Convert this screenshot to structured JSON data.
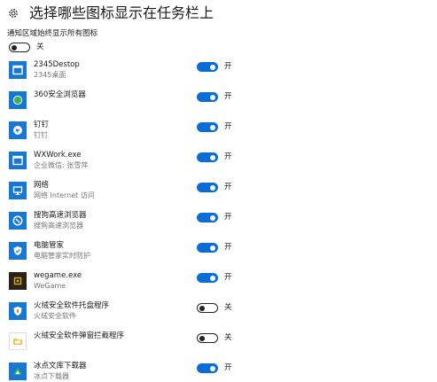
{
  "header": {
    "title": "选择哪些图标显示在任务栏上",
    "icon": "gear-icon"
  },
  "notification_area": {
    "label": "通知区域始终显示所有图标",
    "toggle_state": "关",
    "on": false
  },
  "apps": [
    {
      "name": "2345Destop",
      "sub": "2345桌面",
      "state": "开",
      "on": true,
      "icon": "app-2345-icon",
      "glyph": "window"
    },
    {
      "name": "360安全浏览器",
      "sub": "",
      "state": "开",
      "on": true,
      "icon": "app-360-browser-icon",
      "glyph": "green-circle"
    },
    {
      "name": "钉钉",
      "sub": "钉钉",
      "state": "开",
      "on": true,
      "icon": "app-dingtalk-icon",
      "glyph": "dingtalk"
    },
    {
      "name": "WXWork.exe",
      "sub": "企业微信: 张雪萍",
      "state": "开",
      "on": true,
      "icon": "app-wxwork-icon",
      "glyph": "window"
    },
    {
      "name": "网络",
      "sub": "网络 Internet 访问",
      "state": "开",
      "on": true,
      "icon": "network-icon",
      "glyph": "monitor"
    },
    {
      "name": "搜狗高速浏览器",
      "sub": "搜狗高速浏览器",
      "state": "开",
      "on": true,
      "icon": "app-sogou-browser-icon",
      "glyph": "sogou"
    },
    {
      "name": "电脑管家",
      "sub": "电脑管家实时防护",
      "state": "开",
      "on": true,
      "icon": "app-pc-manager-icon",
      "glyph": "shield"
    },
    {
      "name": "wegame.exe",
      "sub": "WeGame",
      "state": "开",
      "on": true,
      "icon": "app-wegame-icon",
      "glyph": "wegame"
    },
    {
      "name": "火绒安全软件托盘程序",
      "sub": "火绒安全软件",
      "state": "关",
      "on": false,
      "icon": "app-huorong-tray-icon",
      "glyph": "huorong"
    },
    {
      "name": "火绒安全软件弹窗拦截程序",
      "sub": "",
      "state": "关",
      "on": false,
      "icon": "app-huorong-popup-icon",
      "glyph": "folder"
    },
    {
      "name": "冰点文库下载器",
      "sub": "冰点下载器",
      "state": "开",
      "on": true,
      "icon": "app-bingdian-icon",
      "glyph": "triangle"
    }
  ],
  "colors": {
    "accent": "#0a6cd6",
    "icon_bg": "#1678d3"
  }
}
